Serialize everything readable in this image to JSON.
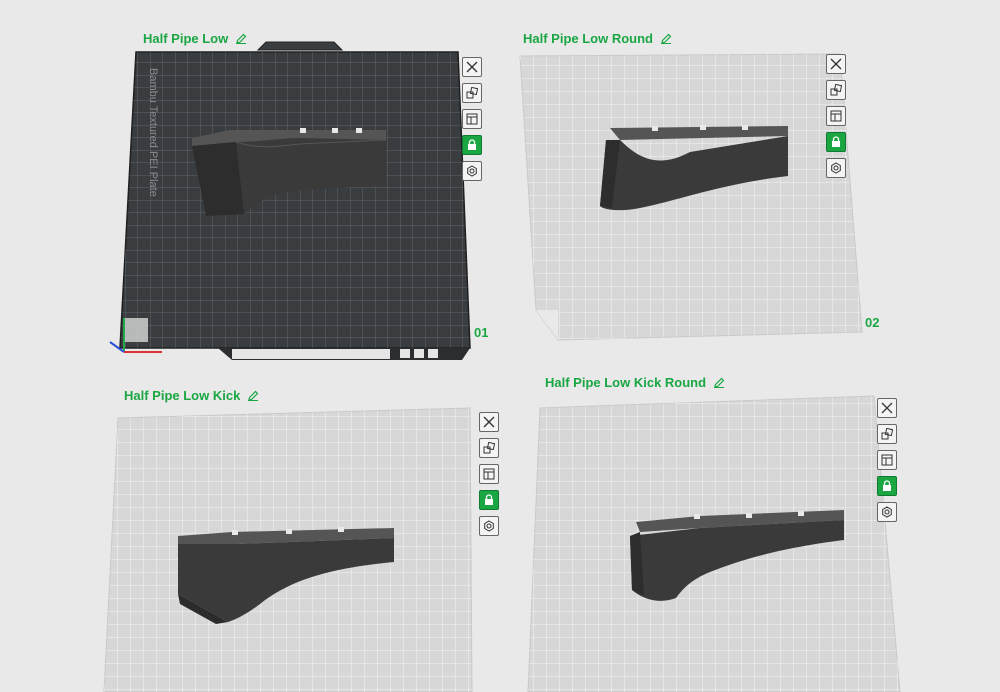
{
  "plates": [
    {
      "name": "Half Pipe Low",
      "number": "01",
      "active": true,
      "bed_label": "Bambu Textured PEI Plate"
    },
    {
      "name": "Half Pipe Low Round",
      "number": "02",
      "active": false
    },
    {
      "name": "Half Pipe Low Kick",
      "number": "",
      "active": false
    },
    {
      "name": "Half Pipe Low Kick Round",
      "number": "",
      "active": false
    }
  ],
  "toolbar_icons": [
    "close-icon",
    "arrange-icon",
    "layout-icon",
    "lock-icon",
    "settings-icon"
  ],
  "colors": {
    "accent": "#1aa643",
    "dark_plate": "#3a3d40",
    "light_plate": "#d7d7d7",
    "background": "#e9e9e9",
    "model": "#3b3b3b"
  }
}
